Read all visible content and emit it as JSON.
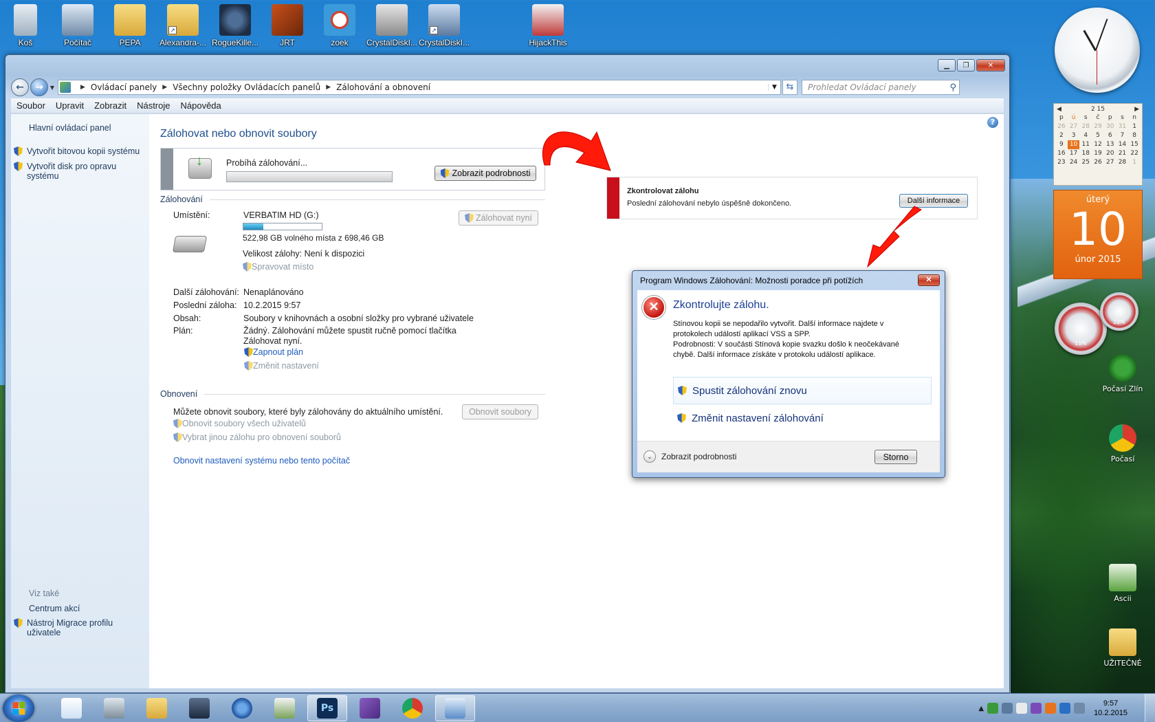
{
  "desktop": {
    "icons": [
      {
        "label": "Koš",
        "icon": "recycle-bin-icon"
      },
      {
        "label": "Počítač",
        "icon": "computer-icon"
      },
      {
        "label": "PEPA",
        "icon": "user-folder-icon"
      },
      {
        "label": "Alexandra-...",
        "icon": "folder-shortcut-icon"
      },
      {
        "label": "RogueKille...",
        "icon": "roguekiller-icon"
      },
      {
        "label": "JRT",
        "icon": "jrt-icon"
      },
      {
        "label": "zoek",
        "icon": "zoek-icon"
      },
      {
        "label": "CrystalDiskI...",
        "icon": "crystaldiskinfo-icon"
      },
      {
        "label": "CrystalDiskI...",
        "icon": "crystaldiskinfo-shortcut-icon"
      },
      {
        "label": "HijackThis",
        "icon": "hijackthis-icon"
      }
    ],
    "right_icons": [
      {
        "label": "Počasí Zlín",
        "icon": "weather-tree-icon"
      },
      {
        "label": "Počasí",
        "icon": "chrome-icon"
      },
      {
        "label": "Ascii",
        "icon": "spreadsheet-icon"
      },
      {
        "label": "UŽITEČNÉ",
        "icon": "folder-icon"
      }
    ]
  },
  "gadgets": {
    "calendar": {
      "header": "2 15",
      "weekdays": [
        "p",
        "ú",
        "s",
        "č",
        "p",
        "s",
        "n"
      ],
      "days": [
        [
          "26",
          "27",
          "28",
          "29",
          "30",
          "31",
          "1"
        ],
        [
          "2",
          "3",
          "4",
          "5",
          "6",
          "7",
          "8"
        ],
        [
          "9",
          "10",
          "11",
          "12",
          "13",
          "14",
          "15"
        ],
        [
          "16",
          "17",
          "18",
          "19",
          "20",
          "21",
          "22"
        ],
        [
          "23",
          "24",
          "25",
          "26",
          "27",
          "28",
          "1"
        ]
      ],
      "today": "10"
    },
    "daycard": {
      "weekday": "úterý",
      "day": "10",
      "month": "únor 2015"
    },
    "gauge_cpu": "11%",
    "gauge_mem": "22%"
  },
  "window": {
    "breadcrumb": [
      "Ovládací panely",
      "Všechny položky Ovládacích panelů",
      "Zálohování a obnovení"
    ],
    "search_placeholder": "Prohledat Ovládací panely",
    "menu": [
      "Soubor",
      "Upravit",
      "Zobrazit",
      "Nástroje",
      "Nápověda"
    ],
    "left_pane": {
      "home": "Hlavní ovládací panel",
      "create_image": "Vytvořit bitovou kopii systému",
      "create_repair_disc": "Vytvořit disk pro opravu systému",
      "see_also": "Viz také",
      "action_center": "Centrum akcí",
      "migration_tool": "Nástroj Migrace profilu uživatele"
    },
    "main": {
      "title": "Zálohovat nebo obnovit soubory",
      "progress_text": "Probíhá zálohování...",
      "show_details_button": "Zobrazit podrobnosti",
      "backup_section": "Zálohování",
      "location_label": "Umístění:",
      "location_value": "VERBATIM HD (G:)",
      "free_space": "522,98 GB volného místa z 698,46 GB",
      "free_space_fraction": 0.25,
      "backup_now_button": "Zálohovat nyní",
      "backup_size": "Velikost zálohy: Není k dispozici",
      "manage_space": "Spravovat místo",
      "next_backup_label": "Další zálohování:",
      "next_backup_value": "Nenaplánováno",
      "last_backup_label": "Poslední záloha:",
      "last_backup_value": "10.2.2015 9:57",
      "contents_label": "Obsah:",
      "contents_value": "Soubory v knihovnách a osobní složky pro vybrané uživatele",
      "schedule_label": "Plán:",
      "schedule_value_line1": "Žádný. Zálohování můžete spustit ručně pomocí tlačítka",
      "schedule_value_line2": "Zálohovat nyní.",
      "turn_on_schedule": "Zapnout plán",
      "change_settings": "Změnit nastavení",
      "restore_section": "Obnovení",
      "restore_text": "Můžete obnovit soubory, které byly zálohovány do aktuálního umístění.",
      "restore_button": "Obnovit soubory",
      "restore_all_users": "Obnovit soubory všech uživatelů",
      "select_other_backup": "Vybrat jinou zálohu pro obnovení souborů",
      "recover_system": "Obnovit nastavení systému nebo tento počítač"
    }
  },
  "notification": {
    "title": "Zkontrolovat zálohu",
    "text": "Poslední zálohování nebylo úspěšně dokončeno.",
    "button": "Další informace"
  },
  "dialog": {
    "title": "Program Windows Zálohování: Možnosti poradce při potížích",
    "heading": "Zkontrolujte zálohu.",
    "text_line1": "Stínovou kopii se nepodařilo vytvořit. Další informace najdete v",
    "text_line2": "protokolech událostí aplikací VSS a SPP.",
    "text_line3": "Podrobnosti: V součásti Stínová kopie svazku došlo k neočekávané",
    "text_line4": "chybě. Další informace získáte v protokolu událostí aplikace.",
    "cmd_run_again": "Spustit zálohování znovu",
    "cmd_change_settings": "Změnit nastavení zálohování",
    "show_details": "Zobrazit podrobnosti",
    "cancel": "Storno"
  },
  "taskbar": {
    "time": "9:57",
    "date": "10.2.2015"
  }
}
